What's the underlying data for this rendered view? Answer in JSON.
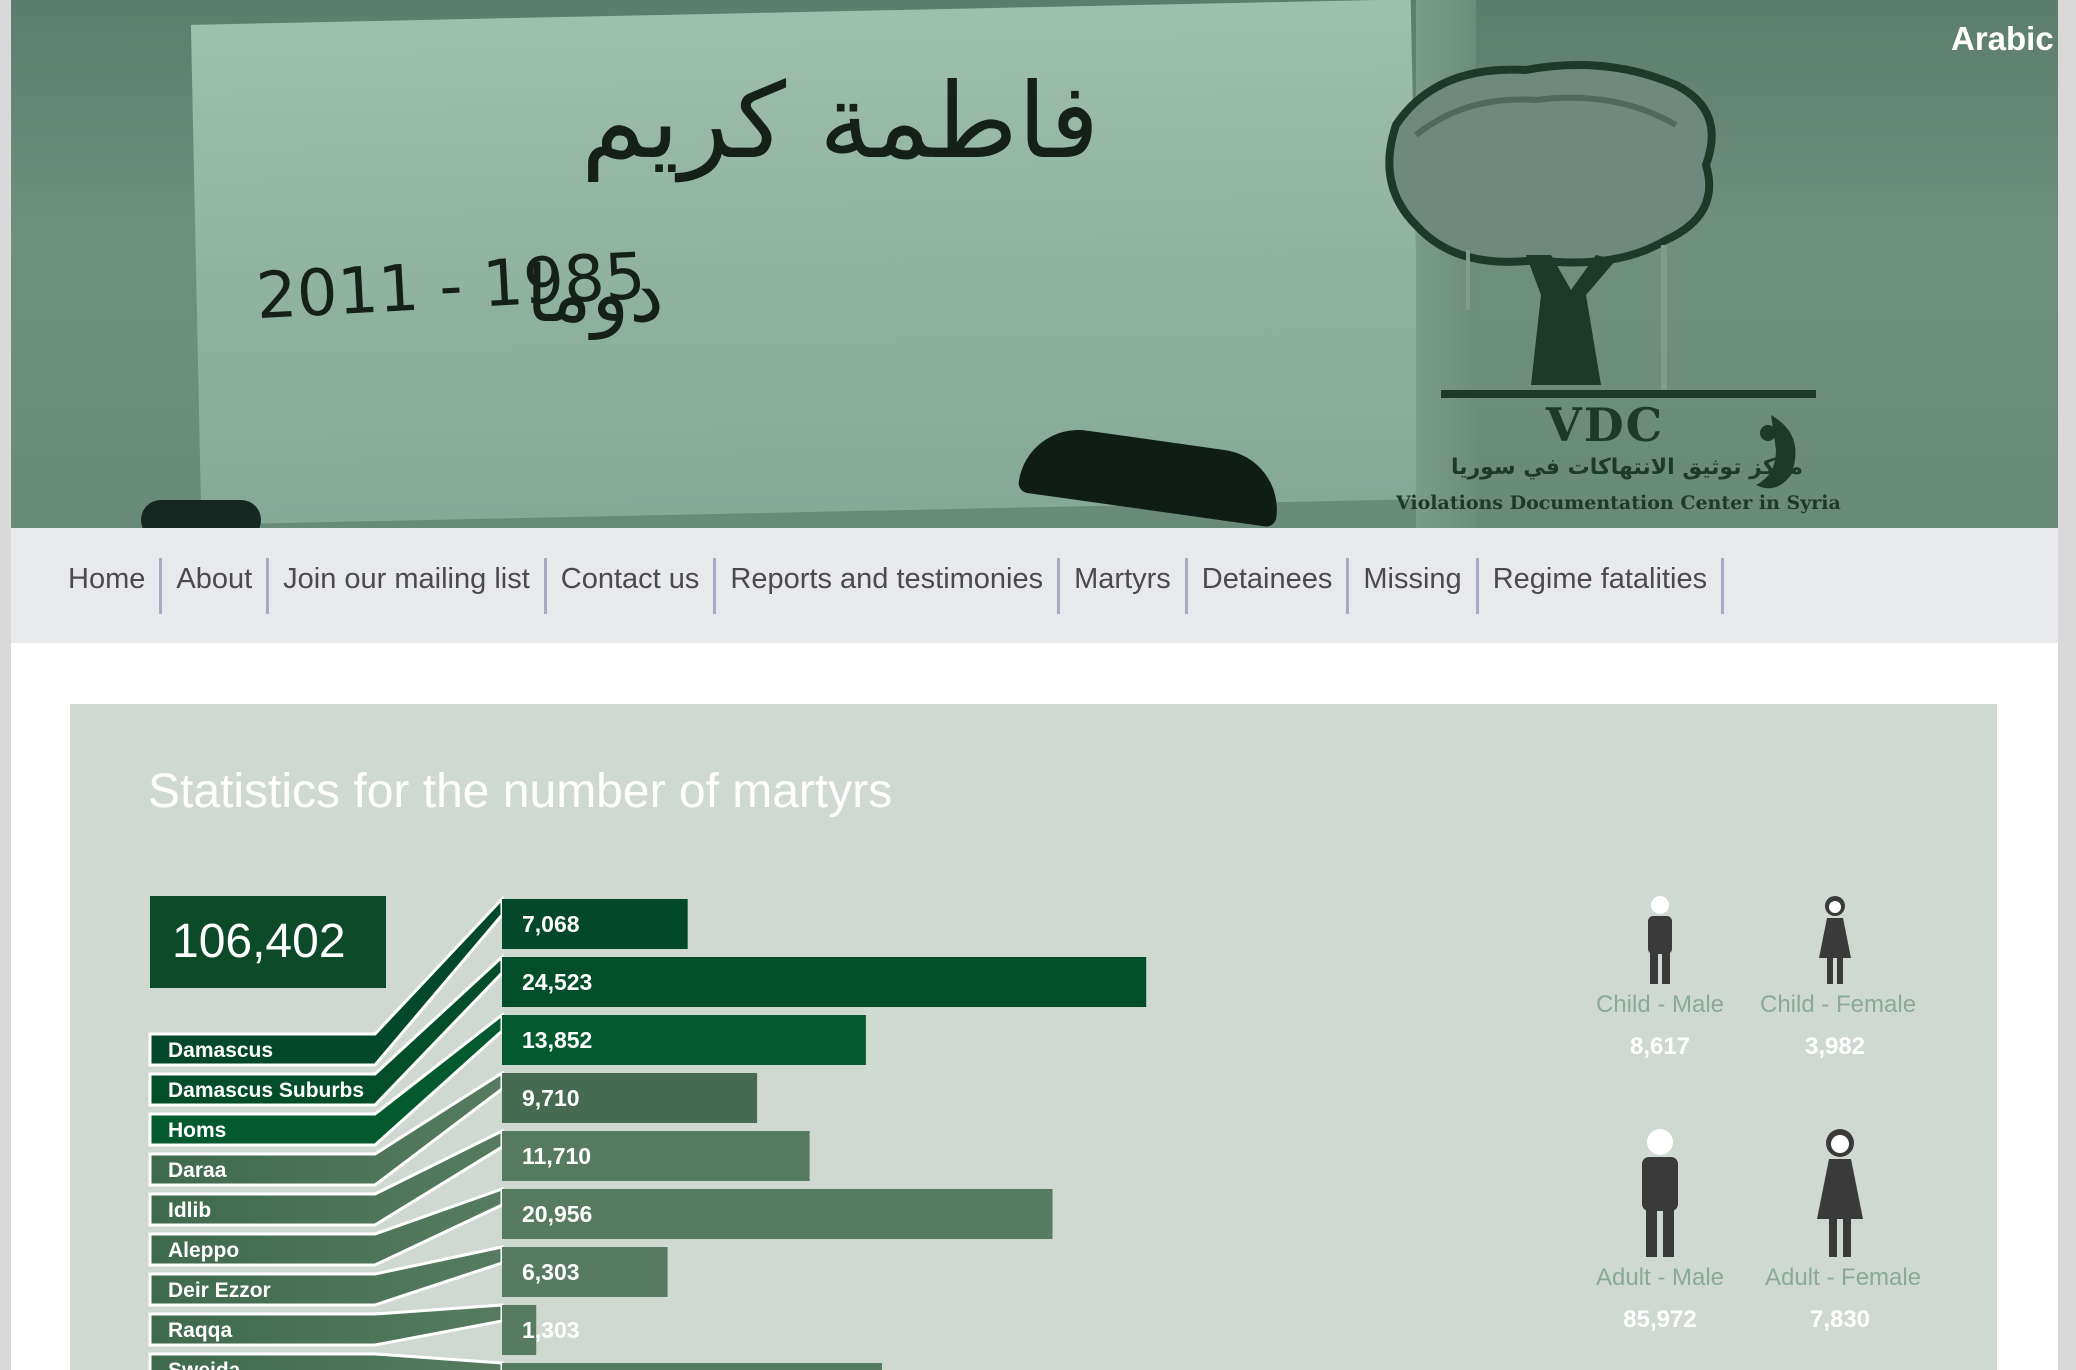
{
  "header": {
    "language_link": "Arabic",
    "photo_text": {
      "name_arabic": "فاطمة كريم",
      "place_arabic": "دوما",
      "years": "2011 - 1985"
    },
    "logo": {
      "acronym": "VDC",
      "arabic_name": "مركز توثيق الانتهاكات في سوريا",
      "english_name": "Violations Documentation Center in Syria"
    }
  },
  "nav": {
    "items": [
      "Home",
      "About",
      "Join our mailing list",
      "Contact us",
      "Reports and testimonies",
      "Martyrs",
      "Detainees",
      "Missing",
      "Regime fatalities"
    ]
  },
  "stats": {
    "title": "Statistics for the number of martyrs",
    "total": "106,402",
    "demographics": [
      {
        "label": "Child - Male",
        "value": "8,617",
        "icon": "child-male-icon"
      },
      {
        "label": "Child - Female",
        "value": "3,982",
        "icon": "child-female-icon"
      },
      {
        "label": "Adult - Male",
        "value": "85,972",
        "icon": "adult-male-icon"
      },
      {
        "label": "Adult - Female",
        "value": "7,830",
        "icon": "adult-female-icon"
      }
    ]
  },
  "chart_data": {
    "type": "bar",
    "categories": [
      "Damascus",
      "Damascus Suburbs",
      "Homs",
      "Daraa",
      "Idlib",
      "Aleppo",
      "Deir Ezzor",
      "Raqqa",
      "Sweida"
    ],
    "values": [
      7068,
      24523,
      13852,
      9710,
      11710,
      20956,
      6303,
      1303,
      null
    ],
    "labels": [
      "7,068",
      "24,523",
      "13,852",
      "9,710",
      "11,710",
      "20,956",
      "6,303",
      "1,303",
      ""
    ],
    "colors": [
      "#03482a",
      "#024d2a",
      "#045a2f",
      "#476b52",
      "#567b60",
      "#567b60",
      "#567b60",
      "#567b60",
      "#567b60"
    ],
    "orientation": "horizontal"
  }
}
